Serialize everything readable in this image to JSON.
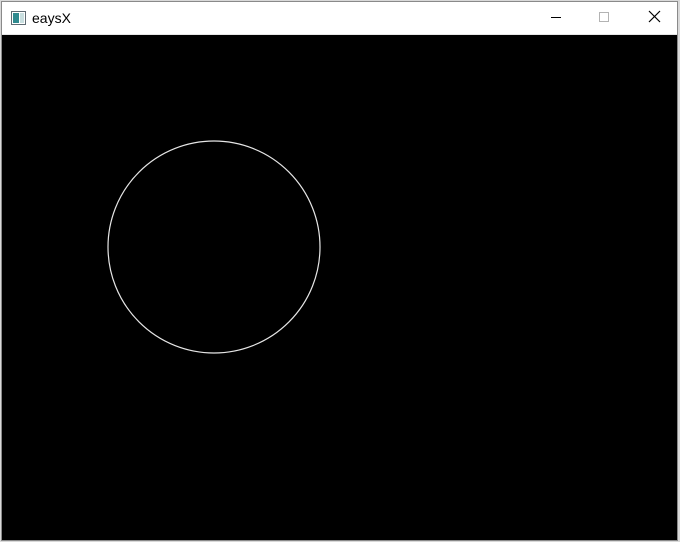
{
  "window": {
    "title": "eaysX",
    "app_icon": "easyx-app-icon",
    "controls": {
      "minimize_icon": "minimize-icon",
      "maximize_icon": "maximize-icon",
      "close_icon": "close-icon"
    }
  },
  "canvas": {
    "background_color": "#000000",
    "shapes": [
      {
        "type": "circle",
        "stroke_color": "#e6e6e6",
        "filled": false
      }
    ]
  }
}
